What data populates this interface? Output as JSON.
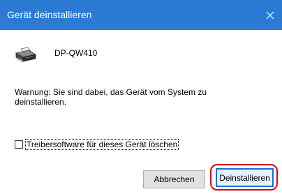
{
  "window": {
    "title": "Gerät deinstallieren"
  },
  "device": {
    "name": "DP-QW410",
    "icon": "printer-icon"
  },
  "message": {
    "warning": "Warnung: Sie sind dabei, das Gerät vom System zu deinstallieren."
  },
  "options": {
    "delete_driver_label": "Treibersoftware für dieses Gerät löschen",
    "delete_driver_checked": false
  },
  "buttons": {
    "cancel_label": "Abbrechen",
    "uninstall_label": "Deinstallieren"
  },
  "colors": {
    "titlebar": "#2b7bd4",
    "highlight_ring": "#d9001b",
    "primary_border": "#1c6fd1"
  }
}
